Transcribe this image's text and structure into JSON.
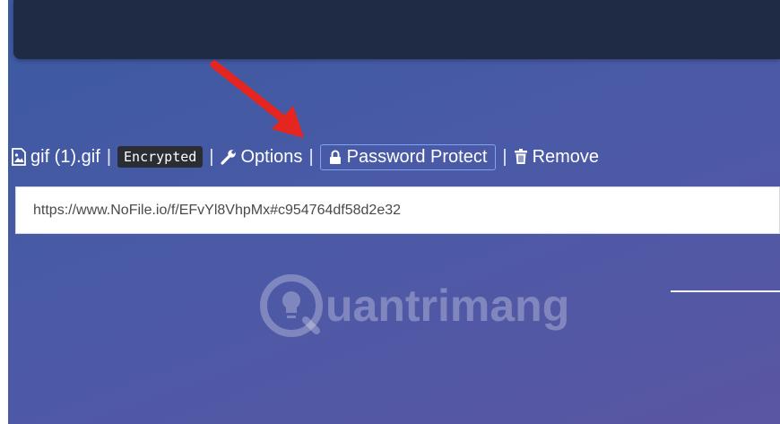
{
  "file": {
    "name": "gif (1).gif",
    "encrypted_badge": "Encrypted",
    "separator": "|"
  },
  "actions": {
    "options_label": "Options",
    "password_label": "Password Protect",
    "remove_label": "Remove"
  },
  "share": {
    "url": "https://www.NoFile.io/f/EFvYl8VhpMx#c954764df58d2e32"
  },
  "watermark": {
    "text": "uantrimang"
  },
  "colors": {
    "background": "#4a5aa6",
    "top_panel": "#1f2a44",
    "arrow": "#e52620",
    "password_border": "#7fa4f2"
  },
  "icons": {
    "file": "image-file-icon",
    "options": "wrench-icon",
    "password": "lock-icon",
    "remove": "trash-icon",
    "pointer": "red-arrow"
  }
}
